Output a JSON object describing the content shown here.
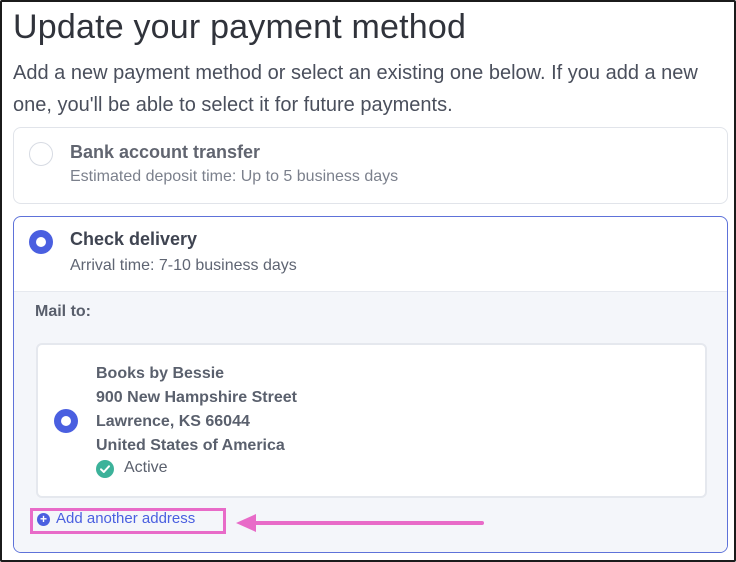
{
  "page": {
    "title": "Update your payment method",
    "subtitle": "Add a new payment method or select an existing one below. If you add a new one, you'll be able to select it for future payments."
  },
  "payment_options": [
    {
      "title": "Bank account transfer",
      "description": "Estimated deposit time: Up to 5 business days",
      "selected": false
    },
    {
      "title": "Check delivery",
      "description": "Arrival time: 7-10 business days",
      "selected": true
    }
  ],
  "mail": {
    "label": "Mail to:",
    "address": {
      "name": "Books by Bessie",
      "street": "900 New Hampshire Street",
      "city_state_zip": "Lawrence, KS 66044",
      "country": "United States of America",
      "status": "Active",
      "selected": true
    },
    "add_link_label": "Add another address"
  },
  "colors": {
    "accent": "#4a5fe0",
    "active_status": "#3cb29a",
    "highlight": "#e86bc8"
  },
  "icons": [
    "radio-empty-icon",
    "radio-selected-icon",
    "check-circle-icon",
    "plus-circle-icon",
    "arrow-left-icon"
  ]
}
